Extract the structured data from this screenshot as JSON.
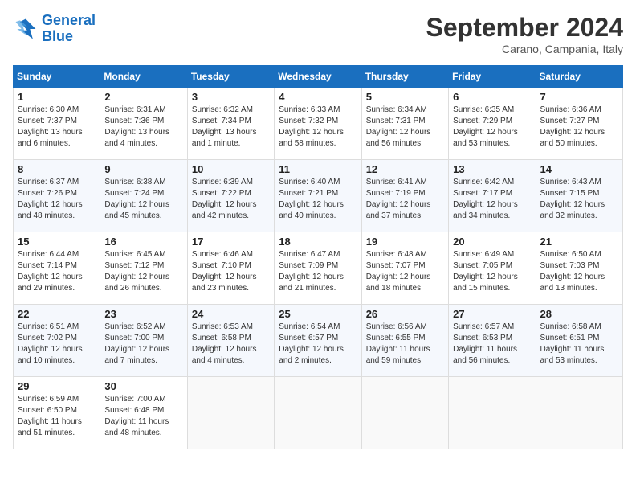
{
  "logo": {
    "general": "General",
    "blue": "Blue"
  },
  "header": {
    "month": "September 2024",
    "location": "Carano, Campania, Italy"
  },
  "weekdays": [
    "Sunday",
    "Monday",
    "Tuesday",
    "Wednesday",
    "Thursday",
    "Friday",
    "Saturday"
  ],
  "weeks": [
    [
      {
        "day": "1",
        "info": "Sunrise: 6:30 AM\nSunset: 7:37 PM\nDaylight: 13 hours and 6 minutes."
      },
      {
        "day": "2",
        "info": "Sunrise: 6:31 AM\nSunset: 7:36 PM\nDaylight: 13 hours and 4 minutes."
      },
      {
        "day": "3",
        "info": "Sunrise: 6:32 AM\nSunset: 7:34 PM\nDaylight: 13 hours and 1 minute."
      },
      {
        "day": "4",
        "info": "Sunrise: 6:33 AM\nSunset: 7:32 PM\nDaylight: 12 hours and 58 minutes."
      },
      {
        "day": "5",
        "info": "Sunrise: 6:34 AM\nSunset: 7:31 PM\nDaylight: 12 hours and 56 minutes."
      },
      {
        "day": "6",
        "info": "Sunrise: 6:35 AM\nSunset: 7:29 PM\nDaylight: 12 hours and 53 minutes."
      },
      {
        "day": "7",
        "info": "Sunrise: 6:36 AM\nSunset: 7:27 PM\nDaylight: 12 hours and 50 minutes."
      }
    ],
    [
      {
        "day": "8",
        "info": "Sunrise: 6:37 AM\nSunset: 7:26 PM\nDaylight: 12 hours and 48 minutes."
      },
      {
        "day": "9",
        "info": "Sunrise: 6:38 AM\nSunset: 7:24 PM\nDaylight: 12 hours and 45 minutes."
      },
      {
        "day": "10",
        "info": "Sunrise: 6:39 AM\nSunset: 7:22 PM\nDaylight: 12 hours and 42 minutes."
      },
      {
        "day": "11",
        "info": "Sunrise: 6:40 AM\nSunset: 7:21 PM\nDaylight: 12 hours and 40 minutes."
      },
      {
        "day": "12",
        "info": "Sunrise: 6:41 AM\nSunset: 7:19 PM\nDaylight: 12 hours and 37 minutes."
      },
      {
        "day": "13",
        "info": "Sunrise: 6:42 AM\nSunset: 7:17 PM\nDaylight: 12 hours and 34 minutes."
      },
      {
        "day": "14",
        "info": "Sunrise: 6:43 AM\nSunset: 7:15 PM\nDaylight: 12 hours and 32 minutes."
      }
    ],
    [
      {
        "day": "15",
        "info": "Sunrise: 6:44 AM\nSunset: 7:14 PM\nDaylight: 12 hours and 29 minutes."
      },
      {
        "day": "16",
        "info": "Sunrise: 6:45 AM\nSunset: 7:12 PM\nDaylight: 12 hours and 26 minutes."
      },
      {
        "day": "17",
        "info": "Sunrise: 6:46 AM\nSunset: 7:10 PM\nDaylight: 12 hours and 23 minutes."
      },
      {
        "day": "18",
        "info": "Sunrise: 6:47 AM\nSunset: 7:09 PM\nDaylight: 12 hours and 21 minutes."
      },
      {
        "day": "19",
        "info": "Sunrise: 6:48 AM\nSunset: 7:07 PM\nDaylight: 12 hours and 18 minutes."
      },
      {
        "day": "20",
        "info": "Sunrise: 6:49 AM\nSunset: 7:05 PM\nDaylight: 12 hours and 15 minutes."
      },
      {
        "day": "21",
        "info": "Sunrise: 6:50 AM\nSunset: 7:03 PM\nDaylight: 12 hours and 13 minutes."
      }
    ],
    [
      {
        "day": "22",
        "info": "Sunrise: 6:51 AM\nSunset: 7:02 PM\nDaylight: 12 hours and 10 minutes."
      },
      {
        "day": "23",
        "info": "Sunrise: 6:52 AM\nSunset: 7:00 PM\nDaylight: 12 hours and 7 minutes."
      },
      {
        "day": "24",
        "info": "Sunrise: 6:53 AM\nSunset: 6:58 PM\nDaylight: 12 hours and 4 minutes."
      },
      {
        "day": "25",
        "info": "Sunrise: 6:54 AM\nSunset: 6:57 PM\nDaylight: 12 hours and 2 minutes."
      },
      {
        "day": "26",
        "info": "Sunrise: 6:56 AM\nSunset: 6:55 PM\nDaylight: 11 hours and 59 minutes."
      },
      {
        "day": "27",
        "info": "Sunrise: 6:57 AM\nSunset: 6:53 PM\nDaylight: 11 hours and 56 minutes."
      },
      {
        "day": "28",
        "info": "Sunrise: 6:58 AM\nSunset: 6:51 PM\nDaylight: 11 hours and 53 minutes."
      }
    ],
    [
      {
        "day": "29",
        "info": "Sunrise: 6:59 AM\nSunset: 6:50 PM\nDaylight: 11 hours and 51 minutes."
      },
      {
        "day": "30",
        "info": "Sunrise: 7:00 AM\nSunset: 6:48 PM\nDaylight: 11 hours and 48 minutes."
      },
      null,
      null,
      null,
      null,
      null
    ]
  ]
}
